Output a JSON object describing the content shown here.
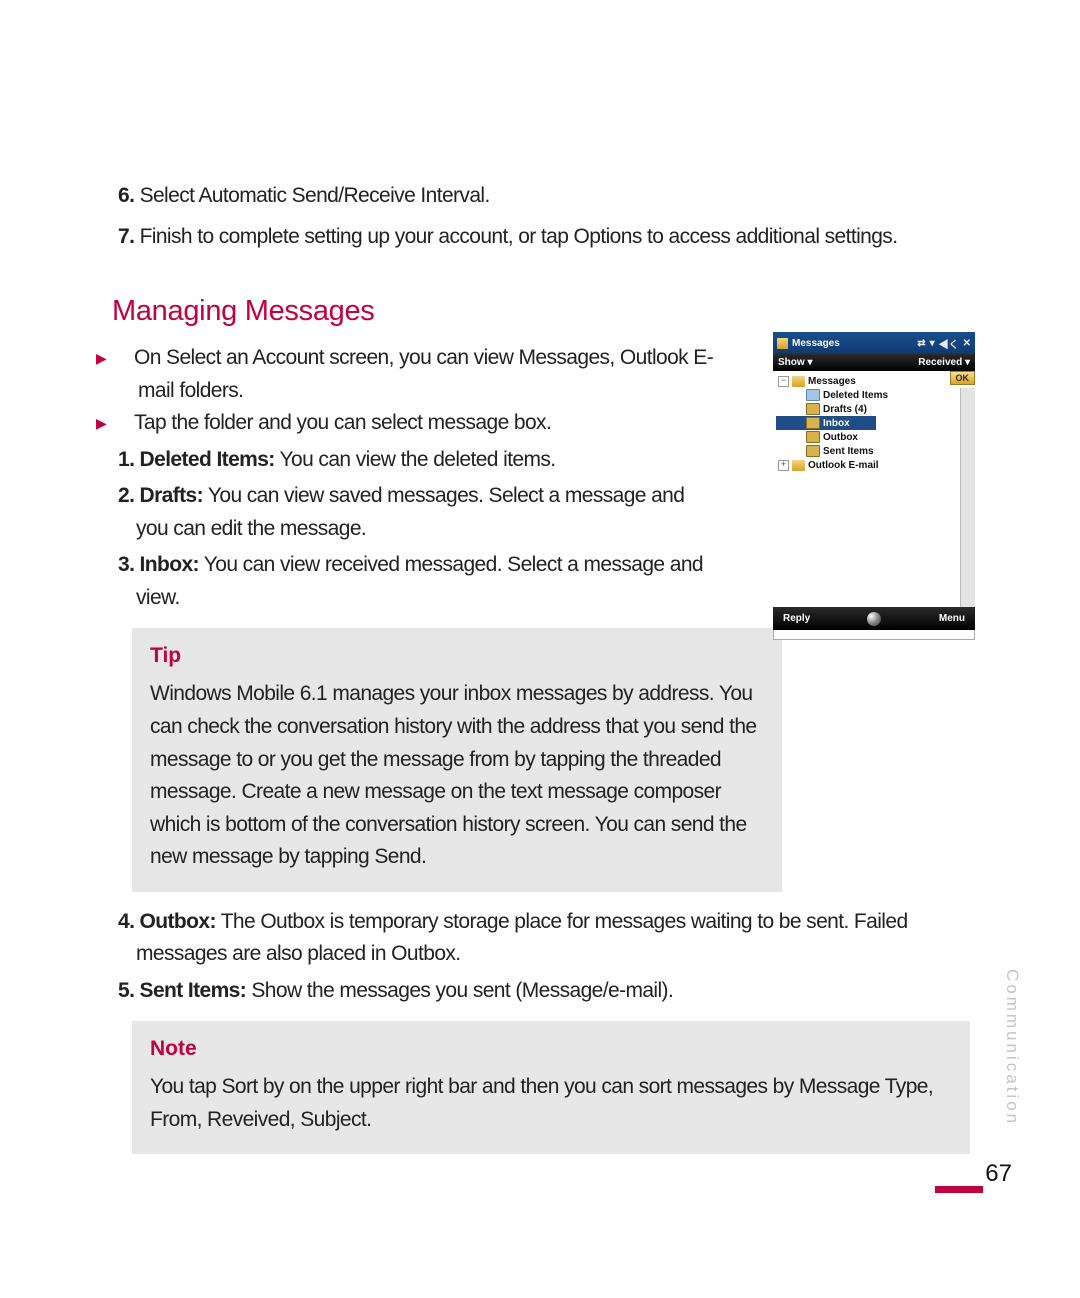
{
  "steps": {
    "six_num": "6.",
    "six_text": " Select Automatic Send/Receive Interval.",
    "seven_num": "7.",
    "seven_text": " Finish to complete setting up your account, or tap Options to access additional settings."
  },
  "section_title": "Managing Messages",
  "bullets": {
    "b1": "On Select an Account screen, you can view Messages, Outlook E-mail folders.",
    "b2": "Tap the folder and you can select message box."
  },
  "items": {
    "i1_num": "1. Deleted Items:",
    "i1_text": " You can view the deleted items.",
    "i2_num": "2. Drafts:",
    "i2_text": " You can view saved messages. Select a message and you can edit the message.",
    "i3_num": "3. Inbox:",
    "i3_text": " You can view received messaged. Select a message and view.",
    "i4_num": "4. Outbox:",
    "i4_text": " The Outbox is temporary storage place for messages waiting to be sent. Failed messages are also placed in Outbox.",
    "i5_num": "5. Sent Items:",
    "i5_text": " Show the messages you sent (Message/e-mail)."
  },
  "tip": {
    "title": "Tip",
    "body": "Windows Mobile 6.1 manages your inbox messages by address. You can check the conversation history with the address that you send the message to or you get the message from by tapping the threaded message. Create a new message on the text message composer which is bottom of the conversation history screen. You can send the new message by tapping Send."
  },
  "note": {
    "title": "Note",
    "body": "You tap Sort by on the upper right bar and then you can sort messages by Message Type, From, Reveived, Subject."
  },
  "sidenote": "Communication",
  "page_number": "67",
  "screenshot": {
    "title": "Messages",
    "toolbar_left": "Show ",
    "toolbar_right": "Received ",
    "ok": "OK",
    "tree": {
      "root": "Messages",
      "deleted": "Deleted Items",
      "drafts": "Drafts (4)",
      "inbox": "Inbox",
      "outbox": "Outbox",
      "sent": "Sent Items",
      "outlook": "Outlook E-mail"
    },
    "bottom_left": "Reply",
    "bottom_right": "Menu"
  }
}
